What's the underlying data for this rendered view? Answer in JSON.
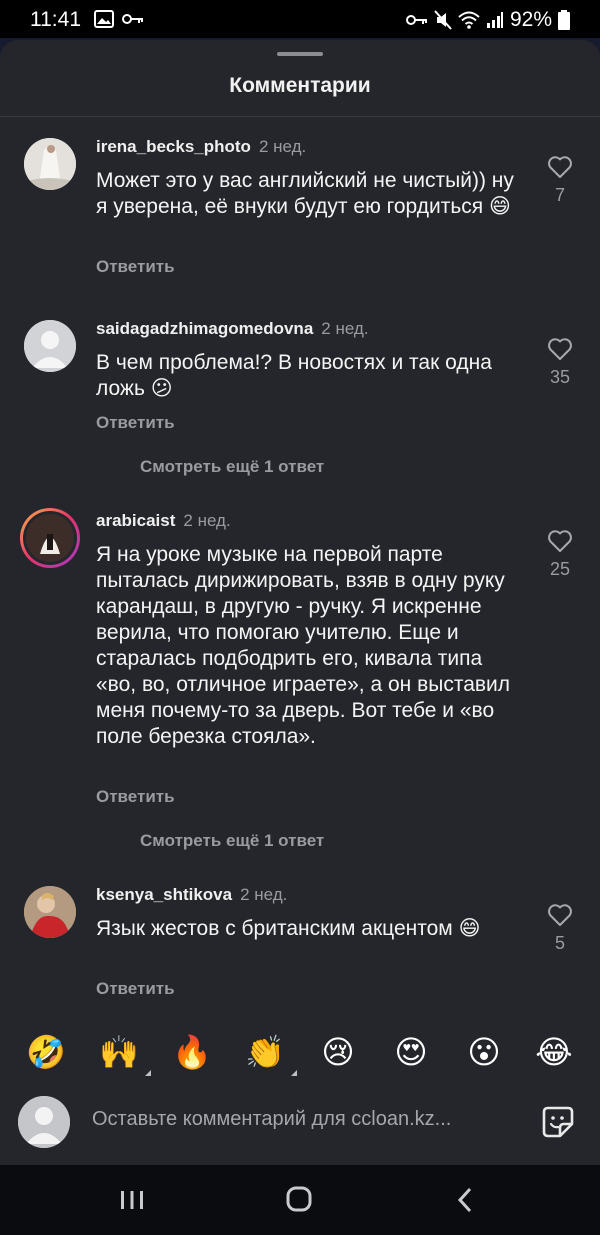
{
  "status_bar": {
    "time": "11:41",
    "battery": "92%"
  },
  "sheet": {
    "title": "Комментарии"
  },
  "comments": [
    {
      "username": "irena_becks_photo",
      "time": "2 нед.",
      "text": "Может это у вас английский не чистый)) ну я уверена, её внуки будут ею гордиться",
      "emoji": "😄",
      "likes": "7",
      "reply_label": "Ответить"
    },
    {
      "username": "saidagadzhimagomedovna",
      "time": "2 нед.",
      "text": "В чем проблема!? В новостях и так одна ложь",
      "emoji": "😕",
      "likes": "35",
      "reply_label": "Ответить",
      "more_replies": "Смотреть ещё 1 ответ"
    },
    {
      "username": "arabicaist",
      "time": "2 нед.",
      "text": "Я на уроке музыке на первой парте пыталась дирижировать, взяв в одну руку карандаш, в другую - ручку. Я искренне верила, что помогаю учителю. Еще и старалась подбодрить его, кивала типа «во, во, отличное играете», а он выставил меня почему-то за дверь. Вот тебе и «во поле березка стояла».",
      "emoji": "",
      "likes": "25",
      "reply_label": "Ответить",
      "more_replies": "Смотреть ещё 1 ответ"
    },
    {
      "username": "ksenya_shtikova",
      "time": "2 нед.",
      "text": "Язык жестов с британским акцентом",
      "emoji": "😄",
      "likes": "5",
      "reply_label": "Ответить"
    }
  ],
  "emoji_bar": [
    "🤣",
    "🙌",
    "🔥",
    "👏",
    "😢",
    "😍",
    "😮",
    "😂"
  ],
  "input": {
    "placeholder": "Оставьте комментарий для ccloan.kz..."
  },
  "colors": {
    "background": "#25262b",
    "muted_text": "#9a9ba0",
    "status_bar": "#000000"
  }
}
